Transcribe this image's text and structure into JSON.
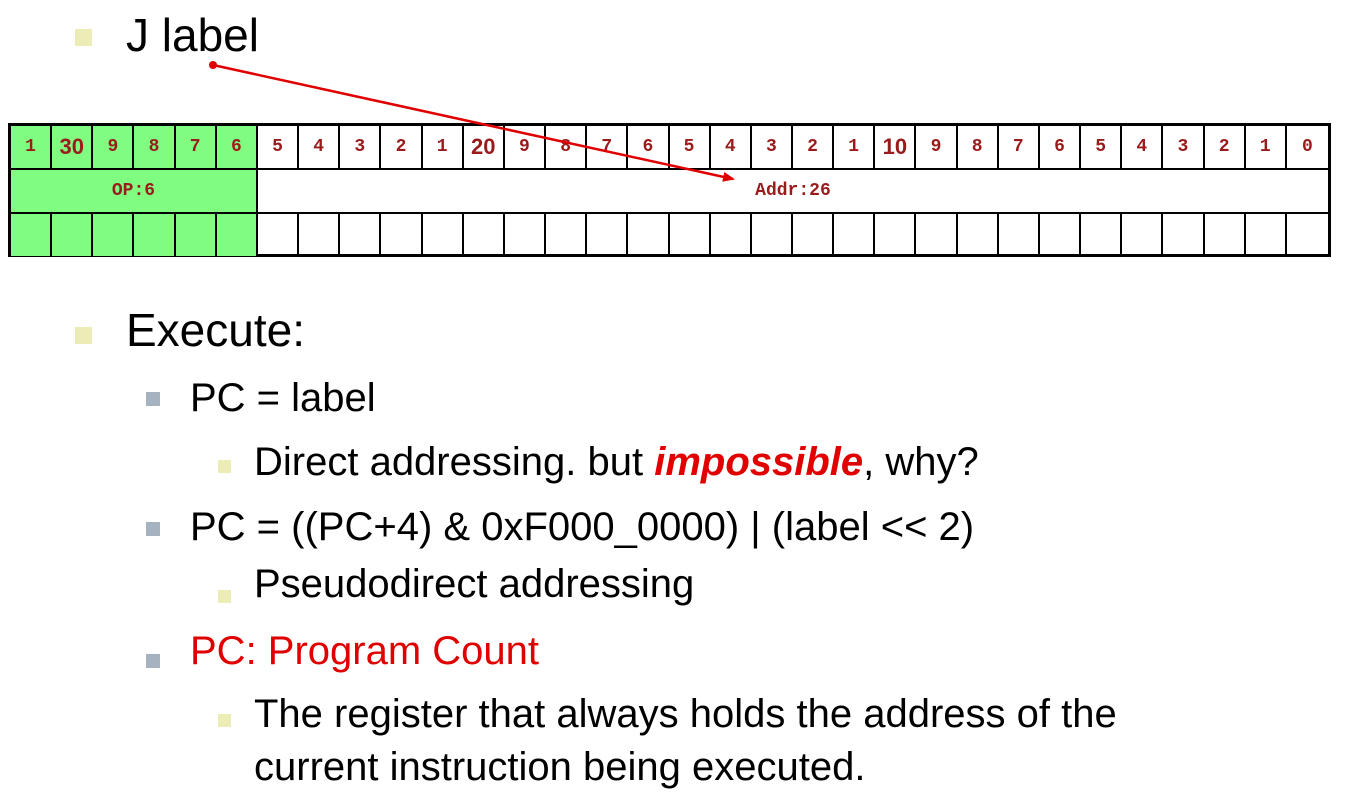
{
  "heading": {
    "label": "J label"
  },
  "format": {
    "bit_labels": [
      "1",
      "30",
      "9",
      "8",
      "7",
      "6",
      "5",
      "4",
      "3",
      "2",
      "1",
      "20",
      "9",
      "8",
      "7",
      "6",
      "5",
      "4",
      "3",
      "2",
      "1",
      "10",
      "9",
      "8",
      "7",
      "6",
      "5",
      "4",
      "3",
      "2",
      "1",
      "0"
    ],
    "fields": [
      {
        "name": "OP:6",
        "bits": 6,
        "color": "#80fc80"
      },
      {
        "name": "Addr:26",
        "bits": 26,
        "color": "#ffffff"
      }
    ]
  },
  "execute": {
    "label": "Execute:",
    "items": [
      {
        "text": "PC = label",
        "sub": {
          "before": "Direct addressing. but ",
          "emph": "impossible",
          "after": ", why?"
        }
      },
      {
        "text": "PC = ((PC+4) & 0xF000_0000) | (label << 2)",
        "sub": {
          "text": "Pseudodirect addressing"
        }
      },
      {
        "text": "PC: Program Count",
        "color": "#e00000",
        "sub": {
          "line1": "The register that always holds the address of the",
          "line2": "current instruction being executed."
        }
      }
    ]
  },
  "colors": {
    "accent_red": "#e00000",
    "bit_text": "#9a1b1b",
    "opcode_fill": "#80fc80",
    "bullet_l1": "#ececb6",
    "bullet_l2": "#a6b2c0"
  }
}
